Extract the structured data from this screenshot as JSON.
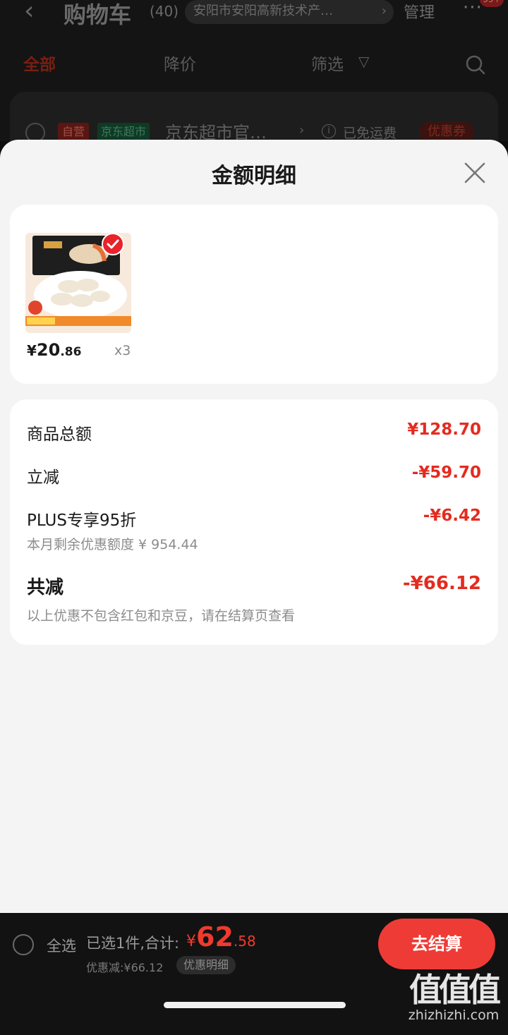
{
  "nav": {
    "title": "购物车",
    "count": "(40)",
    "address": "安阳市安阳高新技术产…",
    "manage": "管理",
    "badge": "99+"
  },
  "tabs": [
    {
      "label": "全部",
      "active": true
    },
    {
      "label": "降价",
      "active": false
    },
    {
      "label": "筛选",
      "active": false
    }
  ],
  "store": {
    "tag_self": "自营",
    "tag_market": "京东超市",
    "name": "京东超市官…",
    "free_shipping": "已免运费",
    "coupon": "优惠券"
  },
  "sheet": {
    "title": "金额明细",
    "product": {
      "price_currency": "¥",
      "price_int": "20",
      "price_dec": ".86",
      "qty": "x3"
    },
    "rows": [
      {
        "label": "商品总额",
        "value": "¥128.70"
      },
      {
        "label": "立减",
        "value": "-¥59.70"
      },
      {
        "label": "PLUS专享95折",
        "value": "-¥6.42",
        "sub": "本月剩余优惠额度 ¥ 954.44"
      }
    ],
    "total": {
      "label": "共减",
      "value": "-¥66.12",
      "note": "以上优惠不包含红包和京豆，请在结算页查看"
    }
  },
  "bottom": {
    "select_all": "全选",
    "selected": "已选1件,合计:",
    "total_currency": "¥",
    "total_int": "62",
    "total_dec": ".58",
    "discount": "优惠减:¥66.12",
    "detail": "优惠明细",
    "checkout": "去结算"
  },
  "watermark": {
    "logo": "值值值",
    "url": "zhizhizhi.com"
  },
  "colors": {
    "accent": "#e42b1f",
    "checkout": "#ef3b36"
  }
}
